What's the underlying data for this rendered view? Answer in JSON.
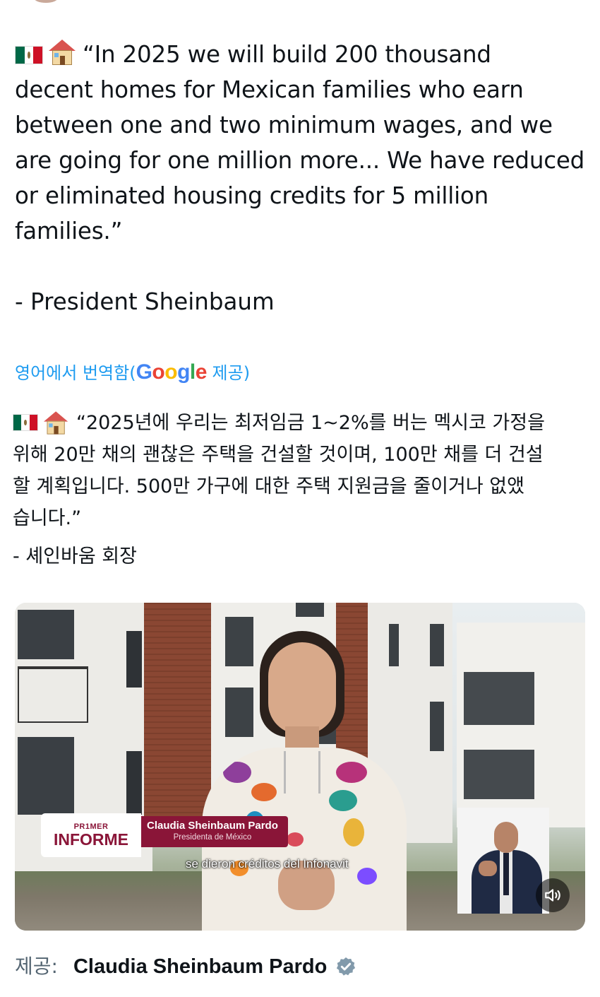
{
  "tweet_en": {
    "lines": [
      "“In 2025 we will build 200 thousand",
      "decent homes for Mexican families who earn",
      "between one and two minimum wages, and we",
      "are going for one million more... We have reduced",
      "or eliminated housing credits for 5 million",
      "families.”"
    ],
    "signature": "- President Sheinbaum"
  },
  "translation": {
    "prefix": "영어에서 번역함(",
    "google": "Google",
    "suffix": " 제공)",
    "brand_colors": [
      "#4285F4",
      "#EA4335",
      "#FBBC05",
      "#4285F4",
      "#34A853",
      "#EA4335"
    ]
  },
  "tweet_ko": {
    "lines": [
      "“2025년에 우리는 최저임금 1~2%를 버는 멕시코 가정을",
      "위해 20만 채의 괜찮은 주택을 건설할 것이며, 100만 채를 더 건설",
      "할 계획입니다. 500만 가구에 대한 주택 지원금을 줄이거나 없앴",
      "습니다.”"
    ],
    "signature": "- 셰인바움 회장"
  },
  "emoji": [
    "flag-mexico-icon",
    "house-icon"
  ],
  "video": {
    "lower_third": {
      "logo_line1": "PR1MER",
      "logo_line2": "INFORME",
      "name": "Claudia Sheinbaum Pardo",
      "title": "Presidenta de México"
    },
    "caption": "se dieron créditos del Infonavit",
    "accent_color": "#8a1538"
  },
  "source": {
    "label": "제공:",
    "name": "Claudia Sheinbaum Pardo",
    "verified_color": "#829aab"
  }
}
